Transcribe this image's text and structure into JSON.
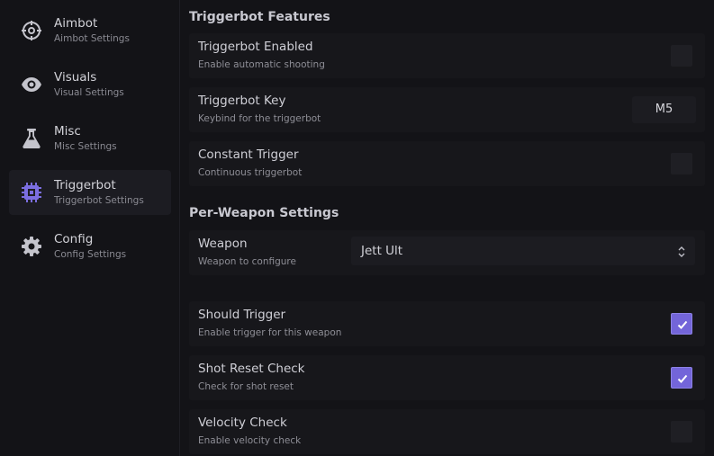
{
  "sidebar": {
    "items": [
      {
        "icon": "crosshair-icon",
        "title": "Aimbot",
        "subtitle": "Aimbot Settings",
        "active": false
      },
      {
        "icon": "eye-icon",
        "title": "Visuals",
        "subtitle": "Visual Settings",
        "active": false
      },
      {
        "icon": "flask-icon",
        "title": "Misc",
        "subtitle": "Misc Settings",
        "active": false
      },
      {
        "icon": "chip-icon",
        "title": "Triggerbot",
        "subtitle": "Triggerbot Settings",
        "active": true
      },
      {
        "icon": "gear-icon",
        "title": "Config",
        "subtitle": "Config Settings",
        "active": false
      }
    ]
  },
  "main": {
    "triggerbot_section": {
      "title": "Triggerbot Features",
      "enabled": {
        "title": "Triggerbot Enabled",
        "desc": "Enable automatic shooting",
        "checked": false
      },
      "key": {
        "title": "Triggerbot Key",
        "desc": "Keybind for the triggerbot",
        "value": "M5"
      },
      "constant": {
        "title": "Constant Trigger",
        "desc": "Continuous triggerbot",
        "checked": false
      }
    },
    "weapon_section": {
      "title": "Per-Weapon Settings",
      "weapon": {
        "title": "Weapon",
        "desc": "Weapon to configure",
        "selected": "Jett Ult"
      },
      "should_trigger": {
        "title": "Should Trigger",
        "desc": "Enable trigger for this weapon",
        "checked": true
      },
      "shot_reset": {
        "title": "Shot Reset Check",
        "desc": "Check for shot reset",
        "checked": true
      },
      "velocity": {
        "title": "Velocity Check",
        "desc": "Enable velocity check",
        "checked": false
      }
    }
  },
  "colors": {
    "background": "#131317",
    "row": "#17171b",
    "accent": "#7365d9",
    "active_icon": "#7b6ee0",
    "icon": "#c4c4cc"
  }
}
